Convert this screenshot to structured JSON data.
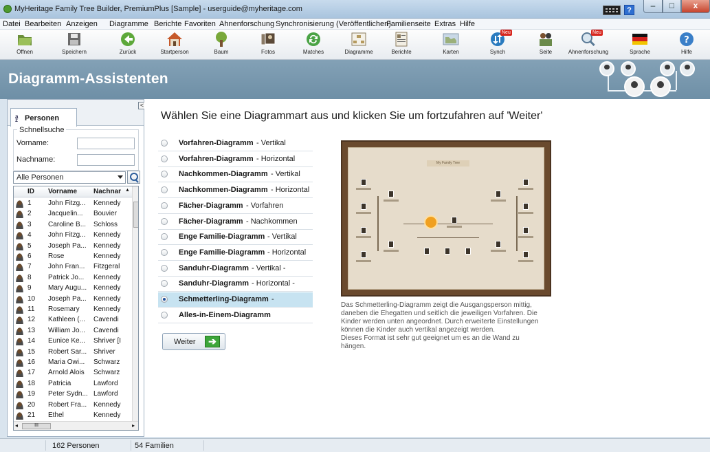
{
  "window": {
    "title": "MyHeritage Family Tree Builder, PremiumPlus [Sample] - userguide@myheritage.com",
    "minimize": "–",
    "maximize": "□",
    "close": "x",
    "help": "?"
  },
  "menu": [
    "Datei",
    "Bearbeiten",
    "Anzeigen",
    "Diagramme",
    "Berichte",
    "Favoriten",
    "Ahnenforschung",
    "Synchronisierung (Veröffentlichen)",
    "Familienseite",
    "Extras",
    "Hilfe"
  ],
  "toolbar": [
    {
      "label": "Öffnen",
      "icon": "folder-icon"
    },
    {
      "label": "Speichern",
      "icon": "save-icon"
    },
    {
      "label": "Zurück",
      "icon": "back-arrow-icon"
    },
    {
      "label": "Startperson",
      "icon": "home-icon"
    },
    {
      "label": "Baum",
      "icon": "tree-icon"
    },
    {
      "label": "Fotos",
      "icon": "photos-icon"
    },
    {
      "label": "Matches",
      "icon": "matches-icon"
    },
    {
      "label": "Diagramme",
      "icon": "chart-icon"
    },
    {
      "label": "Berichte",
      "icon": "reports-icon"
    },
    {
      "label": "Karten",
      "icon": "map-icon"
    },
    {
      "label": "Synch",
      "icon": "sync-icon",
      "badge": "Neu"
    },
    {
      "label": "Seite",
      "icon": "site-icon"
    },
    {
      "label": "Ahnenforschung",
      "icon": "research-icon",
      "badge": "Neu"
    },
    {
      "label": "Sprache",
      "icon": "flag-icon"
    },
    {
      "label": "Hilfe",
      "icon": "help-icon"
    }
  ],
  "banner": {
    "title": "Diagramm-Assistenten"
  },
  "left": {
    "tab": "Personen",
    "collapse": "<",
    "quicksearch": {
      "legend": "Schnellsuche",
      "first_label": "Vorname:",
      "last_label": "Nachname:",
      "first_value": "",
      "last_value": ""
    },
    "filter": "Alle Personen",
    "columns": [
      "ID",
      "Vorname",
      "Nachnar"
    ],
    "rows": [
      {
        "id": "1",
        "first": "John Fitzg...",
        "last": "Kennedy"
      },
      {
        "id": "2",
        "first": "Jacquelin...",
        "last": "Bouvier"
      },
      {
        "id": "3",
        "first": "Caroline B...",
        "last": "Schloss"
      },
      {
        "id": "4",
        "first": "John Fitzg...",
        "last": "Kennedy"
      },
      {
        "id": "5",
        "first": "Joseph Pa...",
        "last": "Kennedy"
      },
      {
        "id": "6",
        "first": "Rose",
        "last": "Kennedy"
      },
      {
        "id": "7",
        "first": "John Fran...",
        "last": "Fitzgeral"
      },
      {
        "id": "8",
        "first": "Patrick Jo...",
        "last": "Kennedy"
      },
      {
        "id": "9",
        "first": "Mary Augu...",
        "last": "Kennedy"
      },
      {
        "id": "10",
        "first": "Joseph Pa...",
        "last": "Kennedy"
      },
      {
        "id": "11",
        "first": "Rosemary",
        "last": "Kennedy"
      },
      {
        "id": "12",
        "first": "Kathleen (...",
        "last": "Cavendi"
      },
      {
        "id": "13",
        "first": "William Jo...",
        "last": "Cavendi"
      },
      {
        "id": "14",
        "first": "Eunice Ke...",
        "last": "Shriver [I"
      },
      {
        "id": "15",
        "first": "Robert Sar...",
        "last": "Shriver"
      },
      {
        "id": "16",
        "first": "Maria Owi...",
        "last": "Schwarz"
      },
      {
        "id": "17",
        "first": "Arnold Alois",
        "last": "Schwarz"
      },
      {
        "id": "18",
        "first": "Patricia",
        "last": "Lawford"
      },
      {
        "id": "19",
        "first": "Peter Sydn...",
        "last": "Lawford"
      },
      {
        "id": "20",
        "first": "Robert Fra...",
        "last": "Kennedy"
      },
      {
        "id": "21",
        "first": "Ethel",
        "last": "Kennedy"
      }
    ],
    "hscroll_grip": "III"
  },
  "main": {
    "prompt": "Wählen Sie eine Diagrammart aus und klicken Sie um fortzufahren auf 'Weiter'",
    "options": [
      {
        "name": "Vorfahren-Diagramm",
        "sub": "- Vertikal",
        "selected": false
      },
      {
        "name": "Vorfahren-Diagramm",
        "sub": "- Horizontal",
        "selected": false
      },
      {
        "name": "Nachkommen-Diagramm",
        "sub": "- Vertikal",
        "selected": false
      },
      {
        "name": "Nachkommen-Diagramm",
        "sub": "- Horizontal",
        "selected": false
      },
      {
        "name": "Fächer-Diagramm",
        "sub": "- Vorfahren",
        "selected": false
      },
      {
        "name": "Fächer-Diagramm",
        "sub": "- Nachkommen",
        "selected": false
      },
      {
        "name": "Enge Familie-Diagramm",
        "sub": "- Vertikal",
        "selected": false
      },
      {
        "name": "Enge Familie-Diagramm",
        "sub": "- Horizontal",
        "selected": false
      },
      {
        "name": "Sanduhr-Diagramm",
        "sub": "- Vertikal -",
        "selected": false
      },
      {
        "name": "Sanduhr-Diagramm",
        "sub": "- Horizontal -",
        "selected": false
      },
      {
        "name": "Schmetterling-Diagramm",
        "sub": "-",
        "selected": true
      },
      {
        "name": "Alles-in-Einem-Diagramm",
        "sub": "",
        "selected": false
      }
    ],
    "next_button": "Weiter",
    "next_arrow": "➔",
    "preview_title": "My Family Tree",
    "description": [
      "Das Schmetterling-Diagramm zeigt die Ausgangsperson mittig,",
      "daneben die Ehegatten und seitlich die jeweiligen Vorfahren. Die",
      "Kinder werden unten angeordnet. Durch erweiterte Einstellungen",
      "können die Kinder auch vertikal angezeigt werden.",
      "Dieses Format ist sehr gut geeignet um es an die Wand zu",
      "hängen."
    ]
  },
  "status": {
    "persons": "162 Personen",
    "families": "54 Familien"
  },
  "colors": {
    "banner": "#7896ab",
    "selected_option": "#c7e3f1",
    "next_arrow": "#3da63a"
  }
}
